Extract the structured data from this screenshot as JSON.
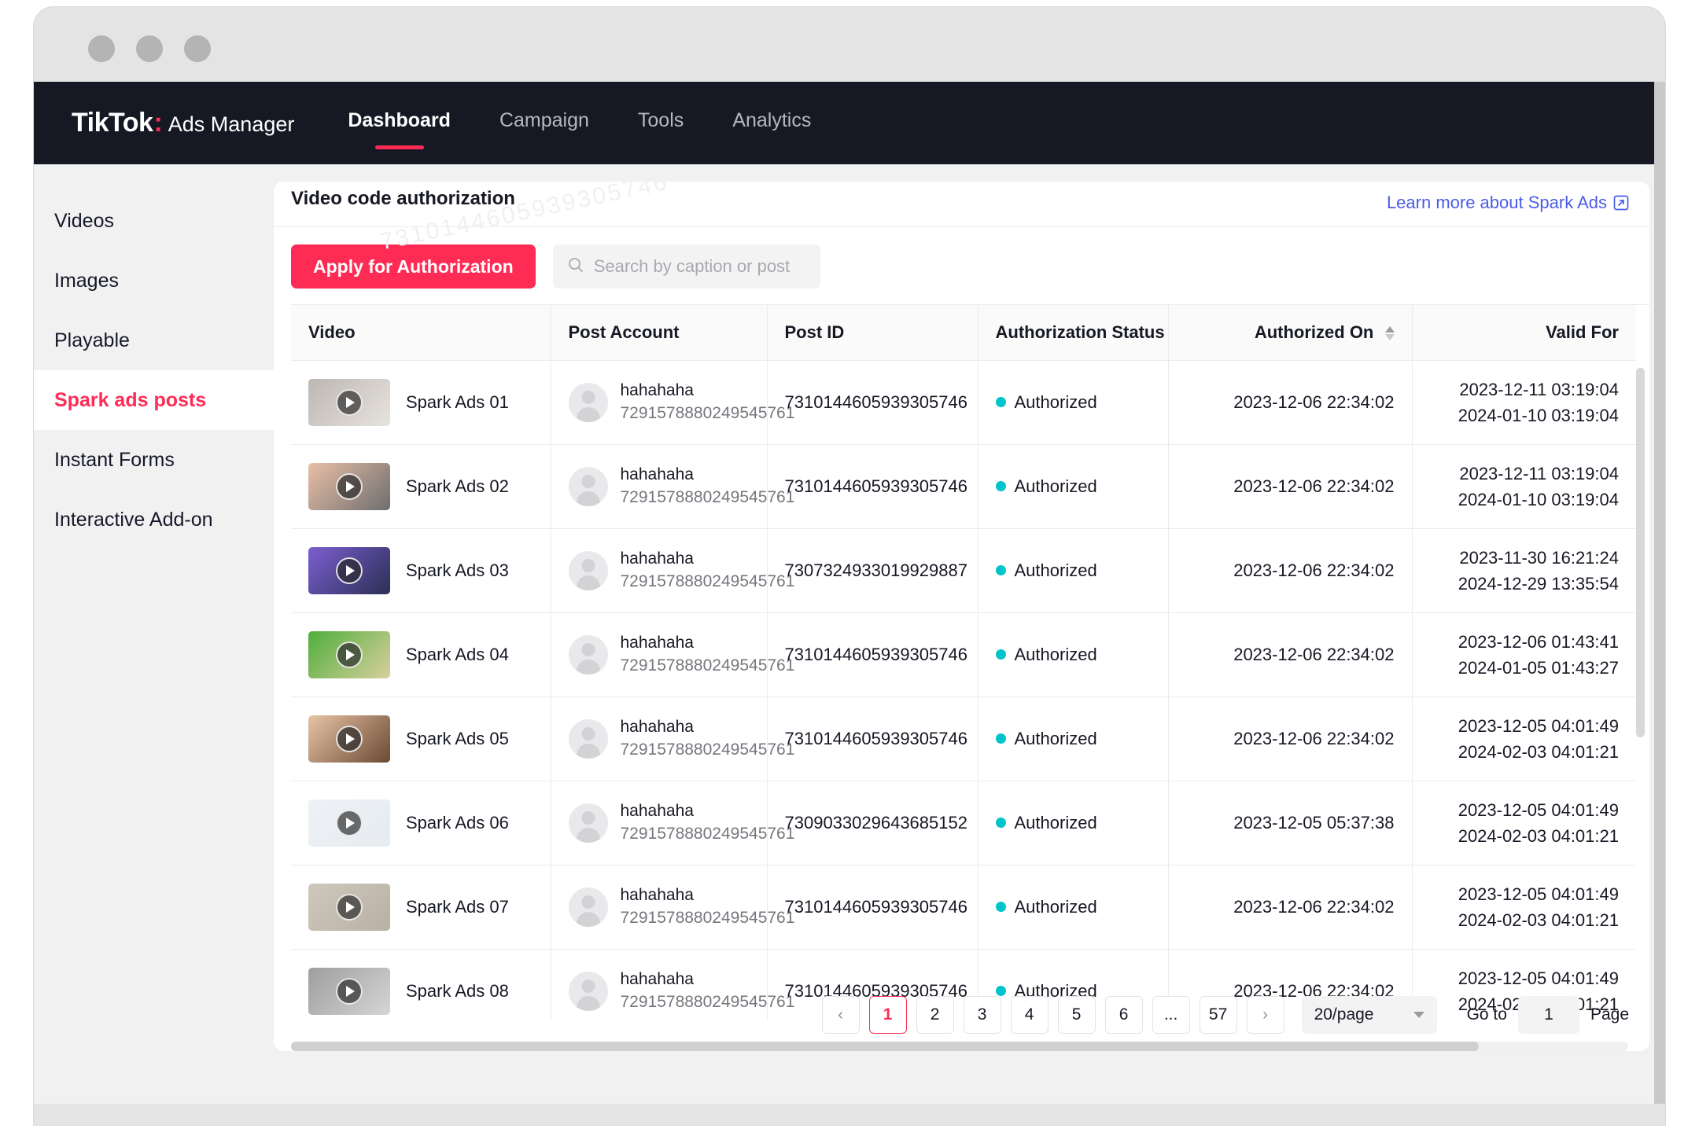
{
  "window": {
    "dots": [
      "close",
      "minimize",
      "maximize"
    ]
  },
  "topnav": {
    "brand_logo": "TikTok",
    "brand_colon": ":",
    "brand_sub": "Ads Manager",
    "items": [
      {
        "label": "Dashboard",
        "active": true
      },
      {
        "label": "Campaign",
        "active": false
      },
      {
        "label": "Tools",
        "active": false
      },
      {
        "label": "Analytics",
        "active": false
      }
    ]
  },
  "sidebar": {
    "items": [
      {
        "label": "Videos",
        "active": false
      },
      {
        "label": "Images",
        "active": false
      },
      {
        "label": "Playable",
        "active": false
      },
      {
        "label": "Spark ads posts",
        "active": true
      },
      {
        "label": "Instant Forms",
        "active": false
      },
      {
        "label": "Interactive Add-on",
        "active": false
      }
    ]
  },
  "panel": {
    "watermark": "7310144605939305746",
    "tab_label": "Video code authorization",
    "learn_link": "Learn more about Spark Ads"
  },
  "toolbar": {
    "apply_label": "Apply for Authorization",
    "search_placeholder": "Search by caption or post ID",
    "search_value": ""
  },
  "table": {
    "headers": [
      "Video",
      "Post Account",
      "Post ID",
      "Authorization Status",
      "Authorized On",
      "Valid For"
    ],
    "sort_column": "Authorized On",
    "rows": [
      {
        "video_name": "Spark Ads 01",
        "thumb_colors": [
          "#bdb7b2",
          "#e7e3df"
        ],
        "account_name": "hahahaha",
        "account_id": "7291578880249545761",
        "post_id": "7310144605939305746",
        "status": "Authorized",
        "authorized_on": "2023-12-06 22:34:02",
        "valid_from": "2023-12-11 03:19:04",
        "valid_to": "2024-01-10 03:19:04"
      },
      {
        "video_name": "Spark Ads 02",
        "thumb_colors": [
          "#e9bfa7",
          "#6e6e6e"
        ],
        "account_name": "hahahaha",
        "account_id": "7291578880249545761",
        "post_id": "7310144605939305746",
        "status": "Authorized",
        "authorized_on": "2023-12-06 22:34:02",
        "valid_from": "2023-12-11 03:19:04",
        "valid_to": "2024-01-10 03:19:04"
      },
      {
        "video_name": "Spark Ads 03",
        "thumb_colors": [
          "#7b5fd0",
          "#2b2f55"
        ],
        "account_name": "hahahaha",
        "account_id": "7291578880249545761",
        "post_id": "7307324933019929887",
        "status": "Authorized",
        "authorized_on": "2023-12-06 22:34:02",
        "valid_from": "2023-11-30 16:21:24",
        "valid_to": "2024-12-29 13:35:54"
      },
      {
        "video_name": "Spark Ads 04",
        "thumb_colors": [
          "#4fae3c",
          "#d9cf9e"
        ],
        "account_name": "hahahaha",
        "account_id": "7291578880249545761",
        "post_id": "7310144605939305746",
        "status": "Authorized",
        "authorized_on": "2023-12-06 22:34:02",
        "valid_from": "2023-12-06 01:43:41",
        "valid_to": "2024-01-05 01:43:27"
      },
      {
        "video_name": "Spark Ads 05",
        "thumb_colors": [
          "#e8c4a6",
          "#6b4a33"
        ],
        "account_name": "hahahaha",
        "account_id": "7291578880249545761",
        "post_id": "7310144605939305746",
        "status": "Authorized",
        "authorized_on": "2023-12-06 22:34:02",
        "valid_from": "2023-12-05 04:01:49",
        "valid_to": "2024-02-03 04:01:21"
      },
      {
        "video_name": "Spark Ads 06",
        "thumb_colors": [
          "#eef2f6",
          "#e6ebf0"
        ],
        "account_name": "hahahaha",
        "account_id": "7291578880249545761",
        "post_id": "7309033029643685152",
        "status": "Authorized",
        "authorized_on": "2023-12-05 05:37:38",
        "valid_from": "2023-12-05 04:01:49",
        "valid_to": "2024-02-03 04:01:21"
      },
      {
        "video_name": "Spark Ads 07",
        "thumb_colors": [
          "#cfc8bd",
          "#b8b0a4"
        ],
        "account_name": "hahahaha",
        "account_id": "7291578880249545761",
        "post_id": "7310144605939305746",
        "status": "Authorized",
        "authorized_on": "2023-12-06 22:34:02",
        "valid_from": "2023-12-05 04:01:49",
        "valid_to": "2024-02-03 04:01:21"
      },
      {
        "video_name": "Spark Ads 08",
        "thumb_colors": [
          "#9e9e9e",
          "#d5d5d5"
        ],
        "account_name": "hahahaha",
        "account_id": "7291578880249545761",
        "post_id": "7310144605939305746",
        "status": "Authorized",
        "authorized_on": "2023-12-06 22:34:02",
        "valid_from": "2023-12-05 04:01:49",
        "valid_to": "2024-02-03 04:01:21"
      }
    ]
  },
  "pagination": {
    "prev": "‹",
    "next": "›",
    "pages": [
      "1",
      "2",
      "3",
      "4",
      "5",
      "6",
      "...",
      "57"
    ],
    "current_page": "1",
    "page_size": "20/page",
    "goto_label": "Go to",
    "goto_value": "1",
    "page_suffix": "Page"
  },
  "colors": {
    "brand_pink": "#fe2c55",
    "status_teal": "#00c4cc",
    "link_blue": "#4b5ce6",
    "nav_dark": "#161823"
  }
}
